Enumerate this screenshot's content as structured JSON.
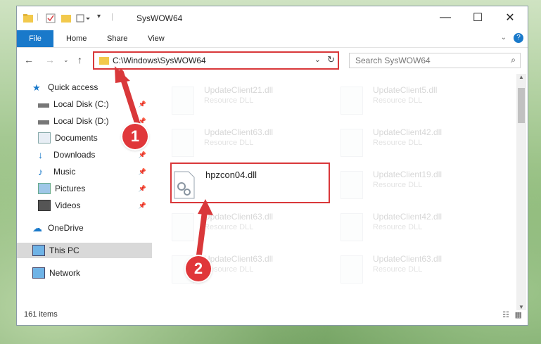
{
  "window": {
    "title": "SysWOW64"
  },
  "ribbon": {
    "tabs": [
      "File",
      "Home",
      "Share",
      "View"
    ]
  },
  "address": {
    "path": "C:\\Windows\\SysWOW64"
  },
  "search": {
    "placeholder": "Search SysWOW64"
  },
  "sidebar": {
    "items": [
      {
        "label": "Quick access"
      },
      {
        "label": "Local Disk (C:)"
      },
      {
        "label": "Local Disk (D:)"
      },
      {
        "label": "Documents"
      },
      {
        "label": "Downloads"
      },
      {
        "label": "Music"
      },
      {
        "label": "Pictures"
      },
      {
        "label": "Videos"
      },
      {
        "label": "OneDrive"
      },
      {
        "label": "This PC"
      },
      {
        "label": "Network"
      }
    ]
  },
  "files": {
    "highlight": {
      "name": "hpzcon04.dll"
    },
    "faded": [
      {
        "name": "UpdateClient21.dll",
        "type": "Resource DLL"
      },
      {
        "name": "UpdateClient5.dll",
        "type": "Resource DLL"
      },
      {
        "name": "UpdateClient63.dll",
        "type": "Resource DLL"
      },
      {
        "name": "UpdateClient42.dll",
        "type": "Resource DLL"
      },
      {
        "name": "UpdateClient19.dll",
        "type": "Resource DLL"
      },
      {
        "name": "UpdateClient63.dll",
        "type": "Resource DLL"
      },
      {
        "name": "UpdateClient42.dll",
        "type": "Resource DLL"
      },
      {
        "name": "UpdateClient63.dll",
        "type": "Resource DLL"
      },
      {
        "name": "UpdateClient63.dll",
        "type": "Resource DLL"
      }
    ]
  },
  "status": {
    "items": "161 items"
  },
  "annotations": {
    "step1": "1",
    "step2": "2"
  },
  "colors": {
    "accent": "#1979ca",
    "highlight": "#d9383a"
  }
}
